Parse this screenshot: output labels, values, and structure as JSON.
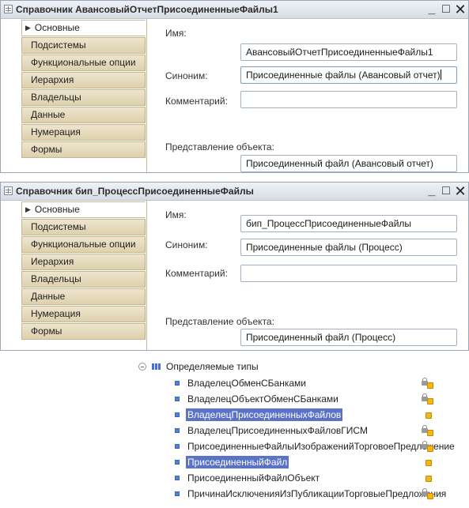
{
  "window1": {
    "title": "Справочник АвансовыйОтчетПрисоединенныеФайлы1",
    "controls": {
      "minimize": "_",
      "maximize": "□",
      "close": "✕"
    },
    "tabs": [
      "Основные",
      "Подсистемы",
      "Функциональные опции",
      "Иерархия",
      "Владельцы",
      "Данные",
      "Нумерация",
      "Формы"
    ],
    "active_tab": 0,
    "name_label": "Имя:",
    "name_value": "АвансовыйОтчетПрисоединенныеФайлы1",
    "synonym_label": "Синоним:",
    "synonym_value": "Присоединенные файлы (Авансовый отчет)",
    "comment_label": "Комментарий:",
    "comment_value": "",
    "object_repr_label": "Представление объекта:",
    "object_repr_value": "Присоединенный файл (Авансовый отчет)"
  },
  "window2": {
    "title": "Справочник бип_ПроцессПрисоединенныеФайлы",
    "controls": {
      "minimize": "_",
      "maximize": "□",
      "close": "✕"
    },
    "tabs": [
      "Основные",
      "Подсистемы",
      "Функциональные опции",
      "Иерархия",
      "Владельцы",
      "Данные",
      "Нумерация",
      "Формы"
    ],
    "active_tab": 0,
    "name_label": "Имя:",
    "name_value": "бип_ПроцессПрисоединенныеФайлы",
    "synonym_label": "Синоним:",
    "synonym_value": "Присоединенные файлы (Процесс)",
    "comment_label": "Комментарий:",
    "comment_value": "",
    "object_repr_label": "Представление объекта:",
    "object_repr_value": "Присоединенный файл (Процесс)"
  },
  "tree": {
    "root_label": "Определяемые типы",
    "items": [
      {
        "label": "ВладелецОбменСБанками",
        "icon": "lock-cube-icon",
        "selected": false
      },
      {
        "label": "ВладелецОбъектОбменСБанками",
        "icon": "lock-cube-icon",
        "selected": false
      },
      {
        "label": "ВладелецПрисоединенныхФайлов",
        "icon": "cube-icon",
        "selected": true
      },
      {
        "label": "ВладелецПрисоединенныхФайловГИСМ",
        "icon": "lock-cube-icon",
        "selected": false
      },
      {
        "label": "ПрисоединенныеФайлыИзображенийТорговоеПредложение",
        "icon": "lock-cube-icon",
        "selected": false
      },
      {
        "label": "ПрисоединенныйФайл",
        "icon": "cube-icon",
        "selected": true
      },
      {
        "label": "ПрисоединенныйФайлОбъект",
        "icon": "cube-icon",
        "selected": false
      },
      {
        "label": "ПричинаИсключенияИзПубликацииТорговыеПредложения",
        "icon": "lock-cube-icon",
        "selected": false
      }
    ]
  },
  "colors": {
    "selection": "#5b73c6",
    "tab_bg": "#e6dcbf",
    "window_border": "#9aa7b6"
  }
}
